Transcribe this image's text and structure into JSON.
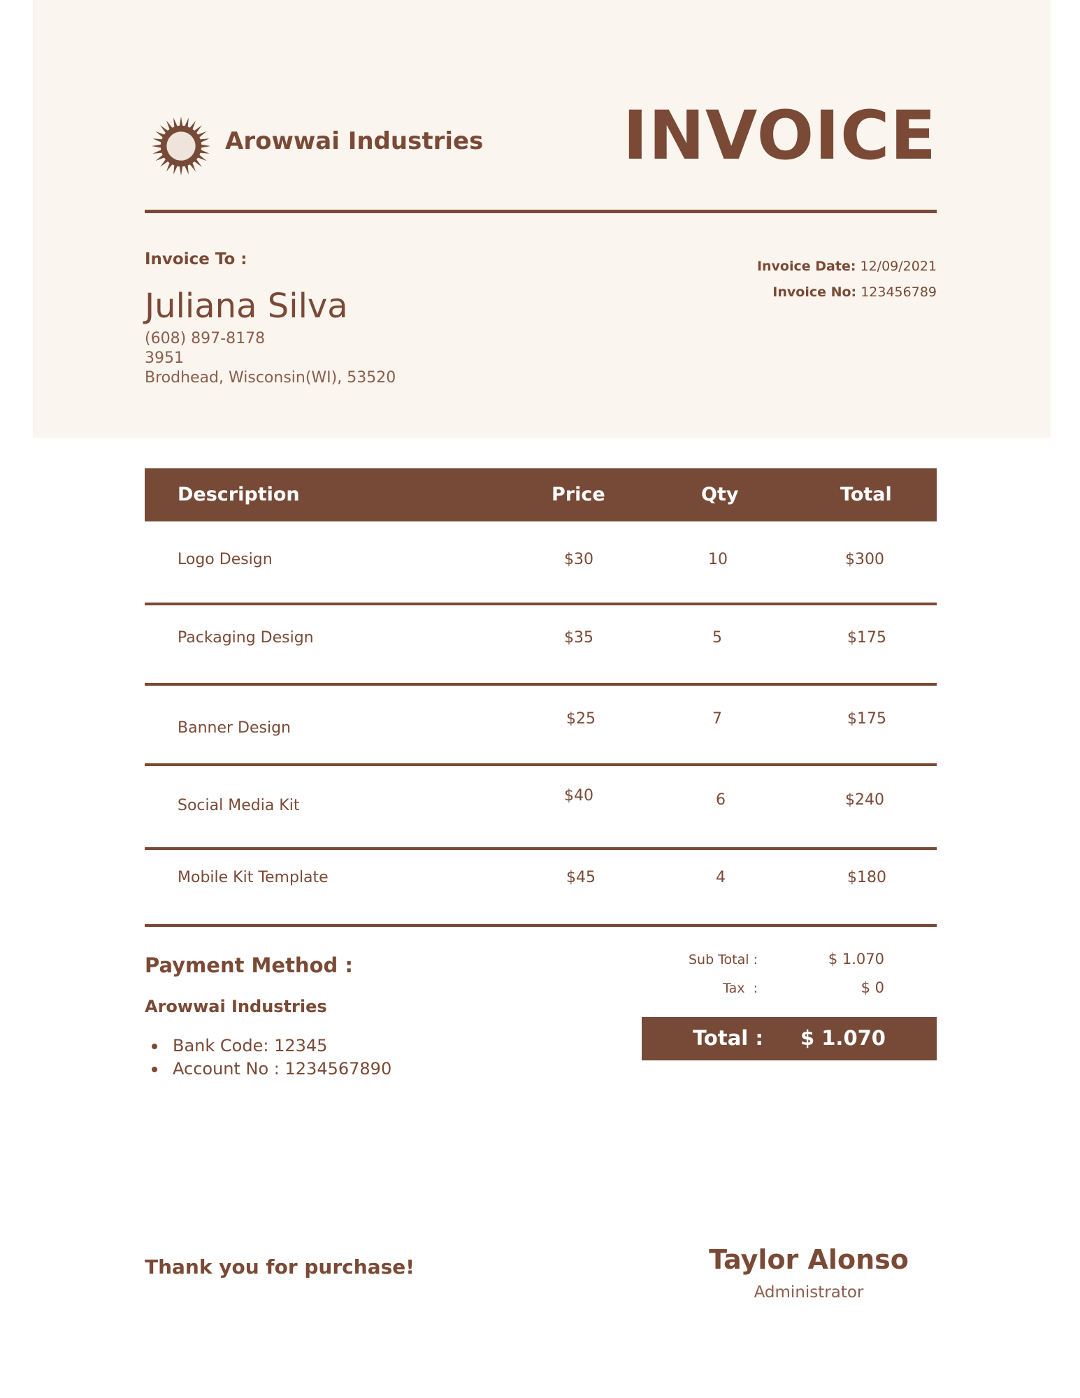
{
  "colors": {
    "brand": "#764a36",
    "header_background": "#faf5ee",
    "text": "#7a4a36"
  },
  "header": {
    "logo_icon": "sunburst-logo-icon",
    "company_name": "Arowwai Industries",
    "title": "INVOICE"
  },
  "bill_to": {
    "label": "Invoice To :",
    "name": "Juliana Silva",
    "phone": "(608) 897-8178",
    "address_line1": "3951",
    "address_line2": "Brodhead, Wisconsin(WI), 53520"
  },
  "meta": {
    "date_label": "Invoice Date:",
    "date_value": "12/09/2021",
    "number_label": "Invoice No:",
    "number_value": "123456789"
  },
  "table": {
    "headers": {
      "description": "Description",
      "price": "Price",
      "qty": "Qty",
      "total": "Total"
    },
    "rows": [
      {
        "description": "Logo Design",
        "price": "$30",
        "qty": "10",
        "total": "$300"
      },
      {
        "description": "Packaging Design",
        "price": "$35",
        "qty": "5",
        "total": "$175"
      },
      {
        "description": "Banner Design",
        "price": "$25",
        "qty": "7",
        "total": "$175"
      },
      {
        "description": "Social Media Kit",
        "price": "$40",
        "qty": "6",
        "total": "$240"
      },
      {
        "description": "Mobile Kit Template",
        "price": "$45",
        "qty": "4",
        "total": "$180"
      }
    ]
  },
  "payment": {
    "title": "Payment Method :",
    "company": "Arowwai Industries",
    "items": [
      "Bank Code: 12345",
      "Account No : 1234567890"
    ]
  },
  "summary": {
    "subtotal_label": "Sub Total :",
    "subtotal_value": "$ 1.070",
    "tax_label": "Tax  :",
    "tax_value": "$ 0",
    "total_label": "Total :",
    "total_value": "$ 1.070"
  },
  "footer": {
    "thanks": "Thank you for purchase!",
    "signer_name": "Taylor Alonso",
    "signer_title": "Administrator"
  }
}
